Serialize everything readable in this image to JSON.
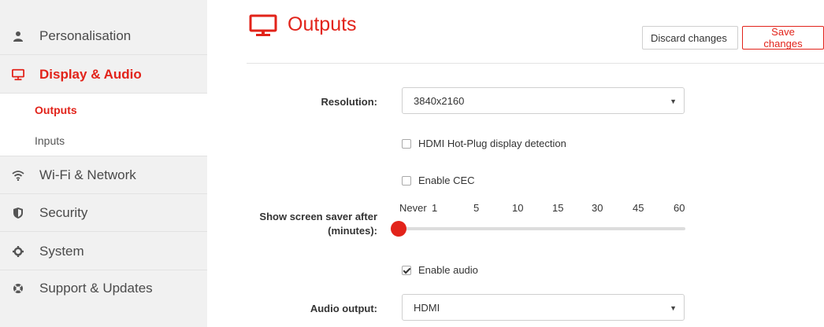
{
  "sidebar": {
    "items": [
      {
        "label": "Personalisation",
        "icon": "user-icon"
      },
      {
        "label": "Display & Audio",
        "icon": "monitor-icon",
        "active": true
      },
      {
        "label": "Wi-Fi & Network",
        "icon": "wifi-icon"
      },
      {
        "label": "Security",
        "icon": "shield-icon"
      },
      {
        "label": "System",
        "icon": "gear-icon"
      },
      {
        "label": "Support & Updates",
        "icon": "lifebuoy-icon"
      }
    ],
    "subitems": [
      {
        "label": "Outputs",
        "active": true
      },
      {
        "label": "Inputs"
      }
    ]
  },
  "header": {
    "title": "Outputs",
    "icon": "monitor-icon",
    "discard_label": "Discard changes",
    "save_label": "Save changes"
  },
  "form": {
    "resolution": {
      "label": "Resolution:",
      "value": "3840x2160"
    },
    "hotplug": {
      "label": "HDMI Hot-Plug display detection",
      "checked": false
    },
    "cec": {
      "label": "Enable CEC",
      "checked": false
    },
    "screensaver": {
      "label_line1": "Show screen saver after",
      "label_line2": "(minutes):",
      "ticks": [
        "Never",
        "1",
        "5",
        "10",
        "15",
        "30",
        "45",
        "60"
      ],
      "selected": "Never"
    },
    "audio_enable": {
      "label": "Enable audio",
      "checked": true
    },
    "audio_output": {
      "label": "Audio output:",
      "value": "HDMI"
    }
  },
  "colors": {
    "accent": "#e2231a",
    "sidebar_bg": "#f1f1f1",
    "slider_track": "#dddddd"
  }
}
